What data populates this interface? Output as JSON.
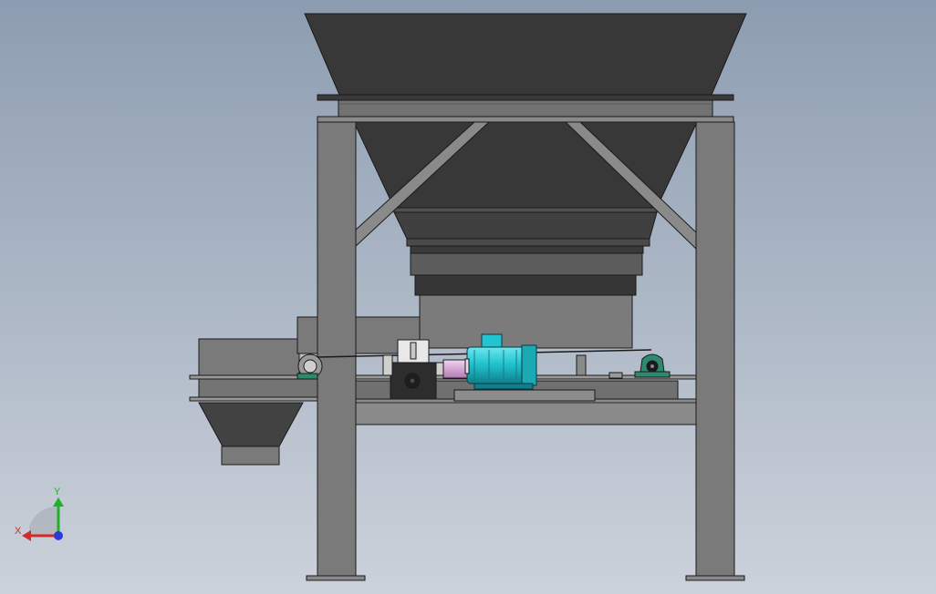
{
  "viewport": {
    "background_top": "#8d9db1",
    "background_bottom": "#ccd2db"
  },
  "colors": {
    "hopper_dark": "#383838",
    "hopper_mid": "#4a4a4a",
    "frame_gray": "#7a7a7a",
    "frame_light": "#8c8c8c",
    "edge": "#1a1a1a",
    "motor_cyan": "#22c4d0",
    "motor_cyan_dark": "#0f7f8c",
    "coupling_pink": "#d7a2d8",
    "bearing_green": "#2e8a6e",
    "gearbox_white": "#e8e8e8"
  },
  "triad": {
    "x_label": "X",
    "y_label": "Y",
    "x_color": "#d42a2a",
    "y_color": "#22b02a",
    "z_color": "#2a3ad4"
  }
}
